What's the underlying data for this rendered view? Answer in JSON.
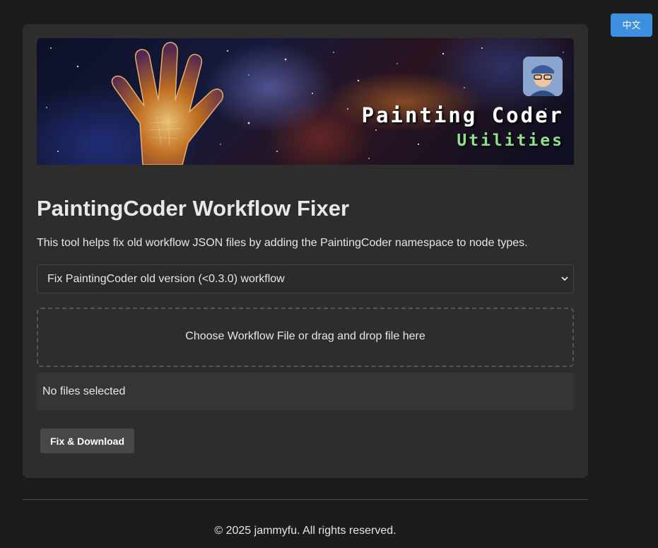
{
  "header": {
    "language_button_label": "中文"
  },
  "banner": {
    "brand_title": "Painting Coder",
    "brand_subtitle": "Utilities"
  },
  "main": {
    "title": "PaintingCoder Workflow Fixer",
    "description": "This tool helps fix old workflow JSON files by adding the PaintingCoder namespace to node types.",
    "select": {
      "selected_value": "Fix PaintingCoder old version (<0.3.0) workflow",
      "icon": "chevron-down-icon"
    },
    "dropzone_label": "Choose Workflow File or drag and drop file here",
    "file_status": "No files selected",
    "fix_button_label": "Fix & Download"
  },
  "footer": {
    "copyright": "© 2025 jammyfu. All rights reserved."
  },
  "colors": {
    "page_background": "#1c1c1c",
    "card_background": "#2d2d2d",
    "language_button": "#3d8fe0",
    "brand_subtitle": "#8fe08f"
  }
}
